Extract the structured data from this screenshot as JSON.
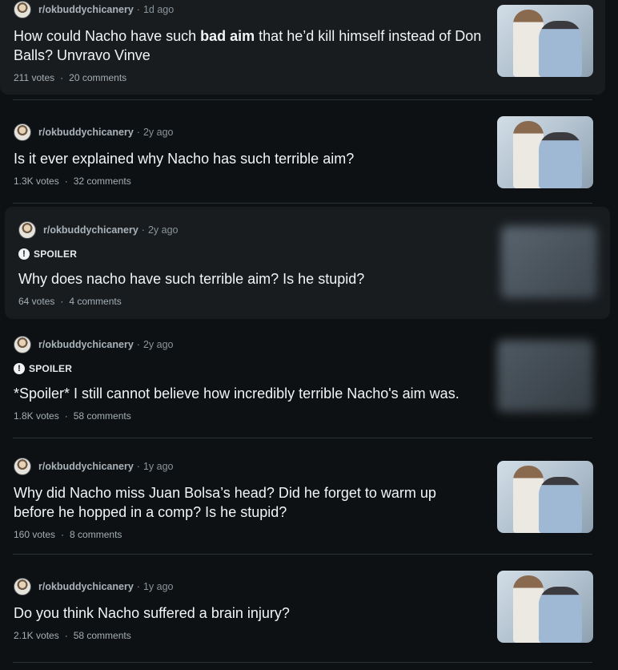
{
  "posts": [
    {
      "subreddit": "r/okbuddychicanery",
      "age": "1d ago",
      "spoiler": false,
      "title_before": "How could Nacho have such ",
      "title_bold": "bad aim",
      "title_after": " that he’d kill himself instead of Don Balls? Unvravo Vinve",
      "votes": "211 votes",
      "comments": "20 comments"
    },
    {
      "subreddit": "r/okbuddychicanery",
      "age": "2y ago",
      "spoiler": false,
      "title": "Is it ever explained why Nacho has such terrible aim?",
      "votes": "1.3K votes",
      "comments": "32 comments"
    },
    {
      "subreddit": "r/okbuddychicanery",
      "age": "2y ago",
      "spoiler": true,
      "spoiler_label": "SPOILER",
      "title": "Why does nacho have such terrible aim? Is he stupid?",
      "votes": "64 votes",
      "comments": "4 comments"
    },
    {
      "subreddit": "r/okbuddychicanery",
      "age": "2y ago",
      "spoiler": true,
      "spoiler_label": "SPOILER",
      "title": "*Spoiler* I still cannot believe how incredibly terrible Nacho's aim was.",
      "votes": "1.8K votes",
      "comments": "58 comments"
    },
    {
      "subreddit": "r/okbuddychicanery",
      "age": "1y ago",
      "spoiler": false,
      "title": "Why did Nacho miss Juan Bolsa’s head? Did he forget to warm up before he hopped in a comp? Is he stupid?",
      "votes": "160 votes",
      "comments": "8 comments"
    },
    {
      "subreddit": "r/okbuddychicanery",
      "age": "1y ago",
      "spoiler": false,
      "title": "Do you think Nacho suffered a brain injury?",
      "votes": "2.1K votes",
      "comments": "58 comments"
    }
  ],
  "separator_dot": "·",
  "colors": {
    "background": "#0e1113",
    "highlight": "#181c1f",
    "divider": "#2a3236",
    "title": "#f2f4f5",
    "meta": "#8a949b"
  }
}
